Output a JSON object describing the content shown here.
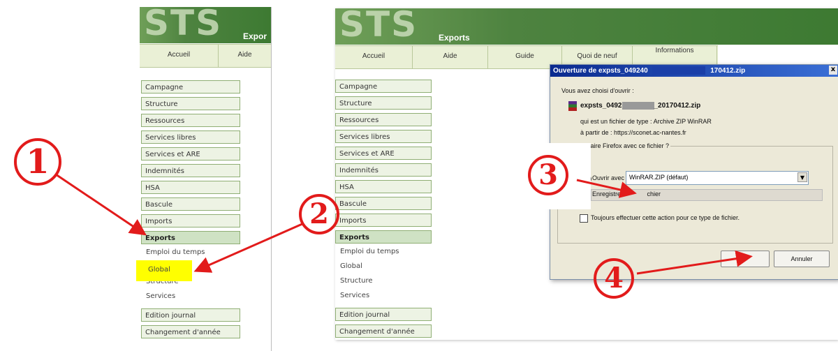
{
  "left_screen": {
    "logo": "STS",
    "app_name": "Expor",
    "nav": [
      "Accueil",
      "Aide"
    ],
    "menu": [
      "Campagne",
      "Structure",
      "Ressources",
      "Services libres",
      "Services et ARE",
      "Indemnités",
      "HSA",
      "Bascule",
      "Imports",
      "Exports"
    ],
    "submenu": [
      "Emploi du temps",
      "Global",
      "Structure",
      "Services"
    ],
    "menu_after": [
      "Edition journal",
      "Changement d'année"
    ]
  },
  "right_screen": {
    "logo": "STS",
    "app_name": "Exports",
    "nav": [
      "Accueil",
      "Aide",
      "Guide",
      "Quoi de neuf",
      "Informations"
    ],
    "menu": [
      "Campagne",
      "Structure",
      "Ressources",
      "Services libres",
      "Services et ARE",
      "Indemnités",
      "HSA",
      "Bascule",
      "Imports",
      "Exports"
    ],
    "submenu": [
      "Emploi du temps",
      "Global",
      "Structure",
      "Services"
    ],
    "menu_after": [
      "Edition journal",
      "Changement d'année"
    ]
  },
  "dialog": {
    "title_left": "Ouverture de expsts_049240",
    "title_right": "170412.zip",
    "close": "x",
    "chose_text": "Vous avez choisi d'ouvrir :",
    "file_left": "expsts_0492",
    "file_right": "_20170412.zip",
    "type_text": "qui est un fichier de type : Archive ZIP WinRAR",
    "from_text": "à partir de : https://sconet.ac-nantes.fr",
    "question": "t faire Firefox avec ce fichier ?",
    "open_with_label": "Ouvrir avec",
    "open_with_value": "WinRAR.ZIP (défaut)",
    "save_label_left": "Enregistrer l",
    "save_label_right": "chier",
    "always_label": "Toujours effectuer cette action pour ce type de fichier.",
    "ok_label": "",
    "cancel_label": "Annuler"
  },
  "steps": [
    "①",
    "②",
    "③",
    "④"
  ],
  "colors": {
    "annotation": "#e21b1b",
    "highlight": "#ffff00",
    "banner": "#4e8340"
  }
}
